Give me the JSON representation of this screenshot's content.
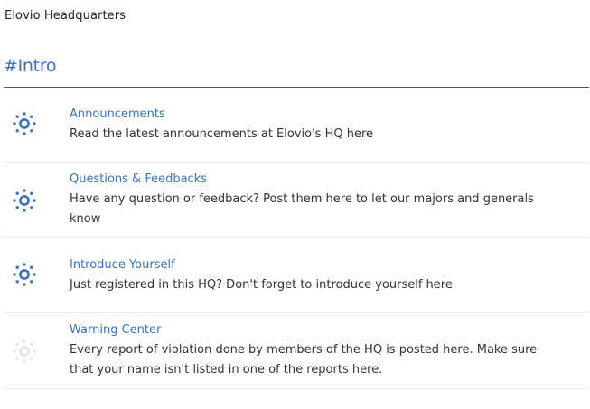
{
  "site": {
    "title": "Elovio Headquarters"
  },
  "section": {
    "title": "#Intro"
  },
  "colors": {
    "link": "#3a73b8",
    "icon_active": "#3a73b8",
    "icon_inactive": "#dfe6ee",
    "text": "#333333"
  },
  "forums": [
    {
      "name": "Announcements",
      "description": "Read the latest announcements at Elovio's HQ here",
      "icon": "forum-read-icon",
      "has_unread": true
    },
    {
      "name": "Questions & Feedbacks",
      "description": "Have any question or feedback? Post them here to let our majors and generals know",
      "icon": "forum-read-icon",
      "has_unread": true
    },
    {
      "name": "Introduce Yourself",
      "description": "Just registered in this HQ? Don't forget to introduce yourself here",
      "icon": "forum-read-icon",
      "has_unread": true
    },
    {
      "name": "Warning Center",
      "description": "Every report of violation done by members of the HQ is posted here. Make sure that your name isn't listed in one of the reports here.",
      "icon": "forum-read-icon",
      "has_unread": false
    }
  ]
}
